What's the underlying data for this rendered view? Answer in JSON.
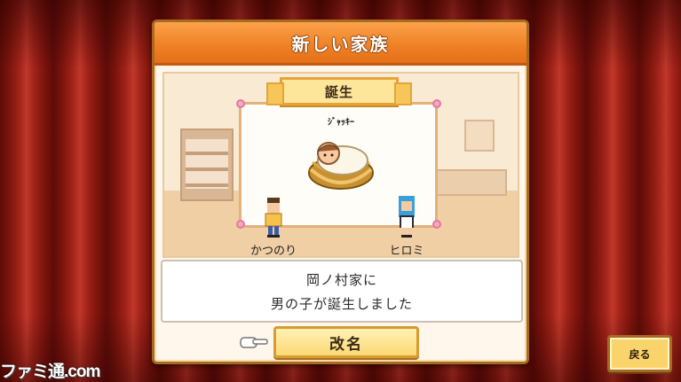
{
  "dialog": {
    "title": "新しい家族",
    "ribbon_label": "誕生",
    "baby_name": "ｼﾞｬｯｷｰ",
    "father_name": "かつのり",
    "mother_name": "ヒロミ",
    "message_line1": "岡ノ村家に",
    "message_line2": "男の子が誕生しました",
    "rename_label": "改名"
  },
  "back_button_label": "戻る",
  "watermark": "ファミ通.com",
  "colors": {
    "header": "#ef7f24",
    "curtain": "#a2241a",
    "button": "#fbd974",
    "dialog_bg": "#fff7ec"
  }
}
